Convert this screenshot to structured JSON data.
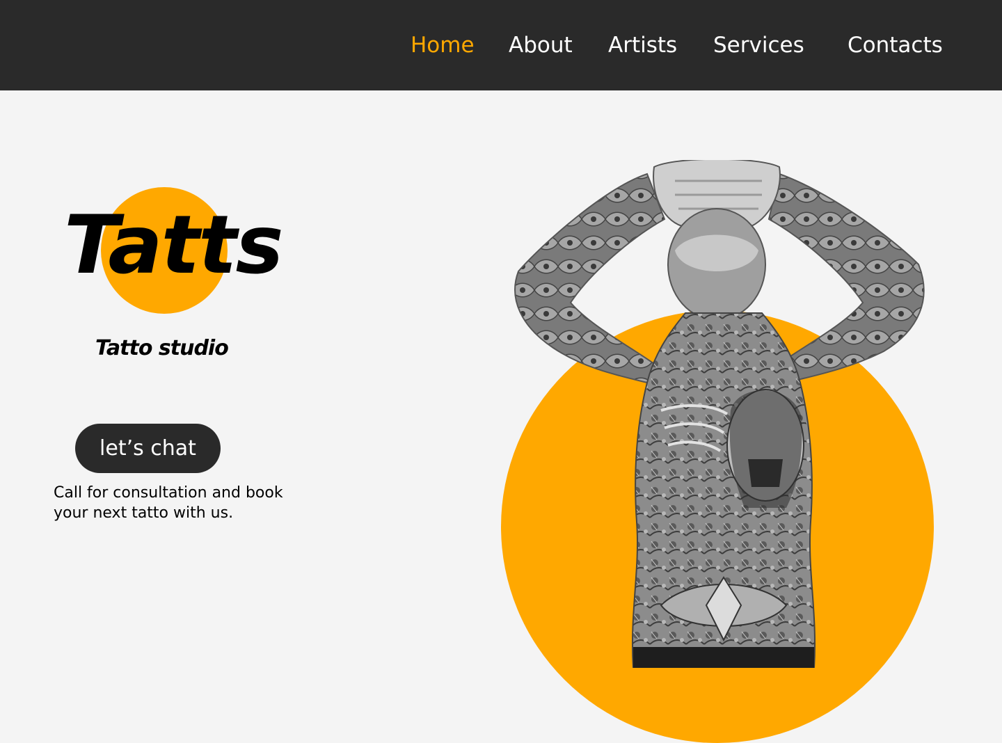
{
  "nav": {
    "items": [
      {
        "label": "Home",
        "active": true
      },
      {
        "label": "About",
        "active": false
      },
      {
        "label": "Artists",
        "active": false
      },
      {
        "label": "Services",
        "active": false
      },
      {
        "label": "Contacts",
        "active": false
      }
    ]
  },
  "hero": {
    "logo": "Tatts",
    "tagline": "Tatto studio",
    "cta_label": "let’s chat",
    "description": "Call for consultation and book your next tatto with us."
  },
  "colors": {
    "accent": "#ffa800",
    "dark": "#2a2a2a",
    "background": "#f4f4f4"
  }
}
